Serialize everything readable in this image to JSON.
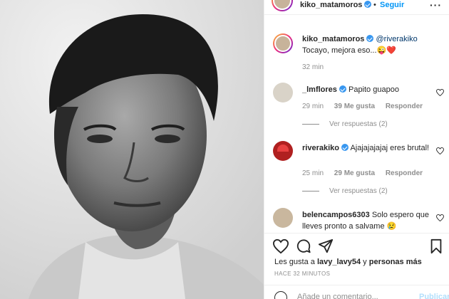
{
  "post": {
    "author": "kiko_matamoros",
    "follow_label": "Seguir",
    "dot": "•"
  },
  "comments": [
    {
      "user": "kiko_matamoros",
      "mention": "@riverakiko",
      "text": "Tocayo, mejora eso...",
      "emoji": "😜❤️",
      "time": "32 min"
    },
    {
      "user": "_lmflores",
      "text": "Papito guapoo",
      "time": "29 min",
      "likes": "39 Me gusta",
      "reply": "Responder",
      "view_replies": "Ver respuestas (2)"
    },
    {
      "user": "riverakiko",
      "text": "Ajajajajajaj eres brutal!",
      "time": "25 min",
      "likes": "29 Me gusta",
      "reply": "Responder",
      "view_replies": "Ver respuestas (2)"
    },
    {
      "user": "belencampos6303",
      "text": "Solo espero que lleves pronto a salvame",
      "emoji": "😢"
    }
  ],
  "likes_line": {
    "prefix": "Les gusta a",
    "user": "lavy_lavy54",
    "middle": "y",
    "others": "personas más"
  },
  "time_ago": "HACE 32 MINUTOS",
  "add_comment": {
    "placeholder": "Añade un comentario...",
    "publish_label": "Publicar"
  },
  "icons": {
    "like": "heart-icon",
    "comment": "comment-icon",
    "share": "share-icon",
    "save": "bookmark-icon",
    "more": "more-icon",
    "verified": "verified-icon",
    "emoji": "emoji-icon"
  },
  "colors": {
    "accent": "#0095f6",
    "verified": "#3897f0",
    "muted": "#8e8e8e"
  }
}
